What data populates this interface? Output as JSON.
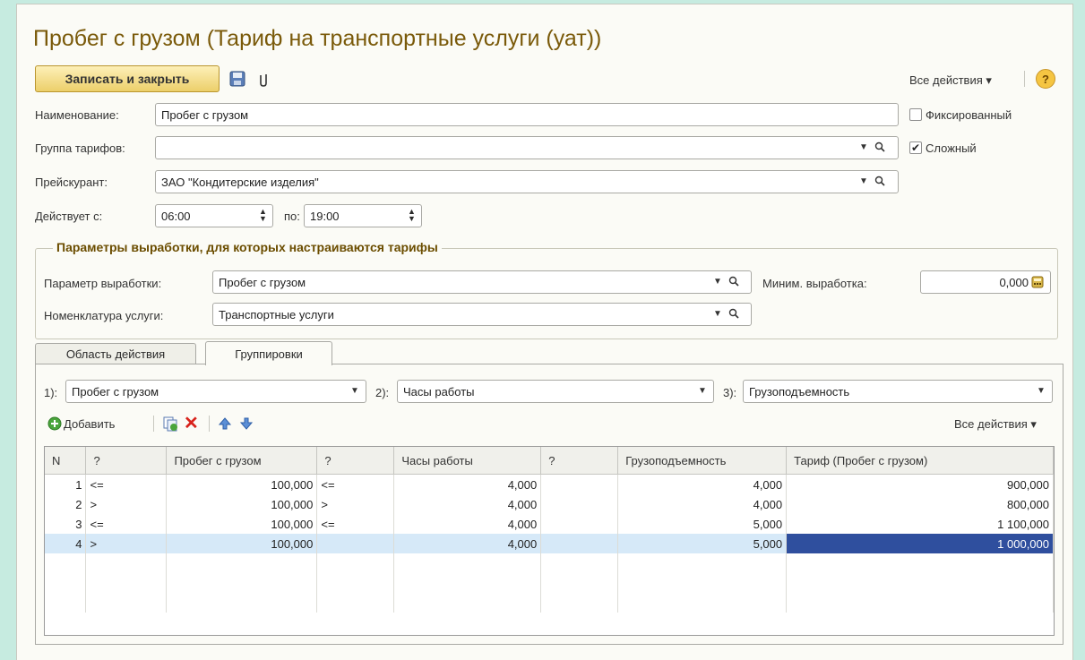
{
  "window": {
    "title": "Пробег с грузом (Тариф на транспортные услуги (уат))"
  },
  "toolbar": {
    "save_close_label": "Записать и закрыть",
    "all_actions_label": "Все действия ▾",
    "help_label": "?"
  },
  "form": {
    "name_label": "Наименование:",
    "name_value": "Пробег с грузом",
    "group_label": "Группа тарифов:",
    "group_value": "",
    "pricelist_label": "Прейскурант:",
    "pricelist_value": "ЗАО \"Кондитерские изделия\"",
    "valid_from_label": "Действует с:",
    "valid_from_value": "06:00",
    "valid_to_label": "по:",
    "valid_to_value": "19:00",
    "fixed_label": "Фиксированный",
    "fixed_checked": false,
    "complex_label": "Сложный",
    "complex_checked": true
  },
  "params": {
    "title": "Параметры выработки, для которых настраиваются тарифы",
    "param_label": "Параметр выработки:",
    "param_value": "Пробег с грузом",
    "min_label": "Миним. выработка:",
    "min_value": "0,000",
    "nomenclature_label": "Номенклатура услуги:",
    "nomenclature_value": "Транспортные услуги"
  },
  "tabs": [
    {
      "label": "Область действия",
      "active": false
    },
    {
      "label": "Группировки",
      "active": true
    }
  ],
  "groupings": {
    "g1_label": "1):",
    "g1_value": "Пробег с грузом",
    "g2_label": "2):",
    "g2_value": "Часы работы",
    "g3_label": "3):",
    "g3_value": "Грузоподъемность"
  },
  "table_toolbar": {
    "add_label": "Добавить",
    "all_actions_label": "Все действия ▾"
  },
  "table": {
    "columns": [
      "N",
      "?",
      "Пробег с грузом",
      "?",
      "Часы работы",
      "?",
      "Грузоподъемность",
      "Тариф (Пробег с грузом)"
    ],
    "rows": [
      [
        "1",
        "<=",
        "100,000",
        "<=",
        "4,000",
        "",
        "4,000",
        "900,000"
      ],
      [
        "2",
        ">",
        "100,000",
        ">",
        "4,000",
        "",
        "4,000",
        "800,000"
      ],
      [
        "3",
        "<=",
        "100,000",
        "<=",
        "4,000",
        "",
        "5,000",
        "1 100,000"
      ],
      [
        "4",
        ">",
        "100,000",
        "",
        "4,000",
        "",
        "5,000",
        "1 000,000"
      ]
    ],
    "selected_row": 3
  },
  "colors": {
    "title": "#7a5a0a",
    "group_title": "#6b4d00",
    "selection": "#d6e9f8",
    "current_cell": "#2f4f9e",
    "save_button": "#f3dd8a"
  }
}
